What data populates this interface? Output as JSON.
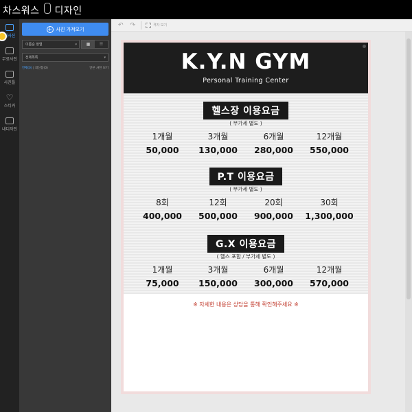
{
  "app": {
    "brand_part1": "차스워스",
    "brand_part2": "디자인"
  },
  "rail": {
    "items": [
      {
        "label": "내사진"
      },
      {
        "label": "무료사진"
      },
      {
        "label": "사진틀"
      },
      {
        "label": "스티커"
      },
      {
        "label": "내디자인"
      }
    ]
  },
  "panel": {
    "import_button": "사진 가져오기",
    "sort_select": "이름순 정렬",
    "folder_select": "전체목록",
    "filter_all": "전체(0)",
    "filter_recent": "| 최신등(0)",
    "filter_unused": "안쓴 사진 보기"
  },
  "toolbar": {
    "undo_icon": "↶",
    "redo_icon": "↷",
    "grid_label": "격자 보기"
  },
  "poster": {
    "title": "K.Y.N GYM",
    "subtitle": "Personal Training Center",
    "sections": [
      {
        "title": "헬스장 이용요금",
        "note": "( 부가세 별도 )",
        "items": [
          {
            "label": "1개월",
            "value": "50,000"
          },
          {
            "label": "3개월",
            "value": "130,000"
          },
          {
            "label": "6개월",
            "value": "280,000"
          },
          {
            "label": "12개월",
            "value": "550,000"
          }
        ]
      },
      {
        "title": "P.T 이용요금",
        "note": "( 부가세 별도 )",
        "items": [
          {
            "label": "8회",
            "value": "400,000"
          },
          {
            "label": "12회",
            "value": "500,000"
          },
          {
            "label": "20회",
            "value": "900,000"
          },
          {
            "label": "30회",
            "value": "1,300,000"
          }
        ]
      },
      {
        "title": "G.X 이용요금",
        "note": "( 헬스 포함 / 부가세 별도 )",
        "items": [
          {
            "label": "1개월",
            "value": "75,000"
          },
          {
            "label": "3개월",
            "value": "150,000"
          },
          {
            "label": "6개월",
            "value": "300,000"
          },
          {
            "label": "12개월",
            "value": "570,000"
          }
        ]
      }
    ],
    "footnote": "※ 자세한 내용은 상담을 통해 확인해주세요 ※"
  }
}
